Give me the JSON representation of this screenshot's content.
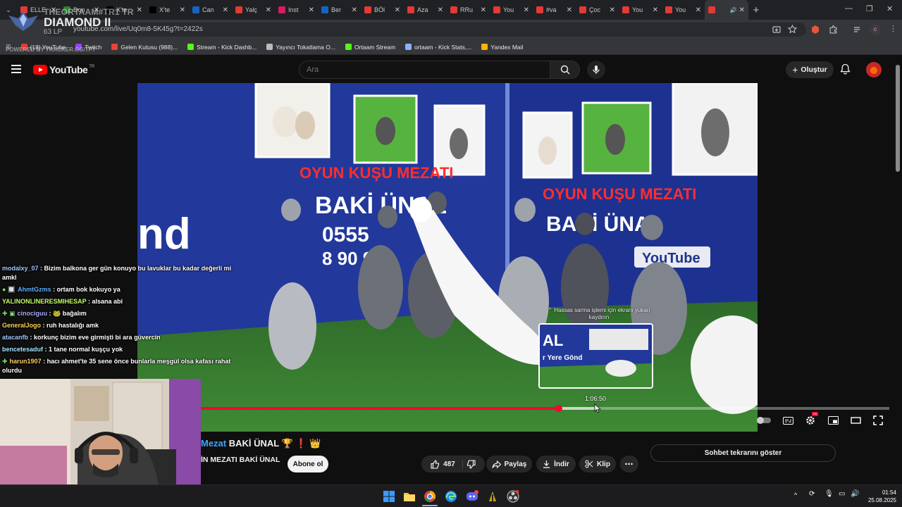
{
  "browser": {
    "tabs": [
      {
        "label": "ELLE",
        "color": "#e53935",
        "icon": "youtube-icon"
      },
      {
        "label": "Don",
        "color": "#2e7d32",
        "icon": "kick-icon"
      },
      {
        "label": "X'te",
        "color": "#000000",
        "icon": "x-icon"
      },
      {
        "label": "X'te",
        "color": "#000000",
        "icon": "x-icon"
      },
      {
        "label": "Can",
        "color": "#1565c0",
        "icon": "m-icon"
      },
      {
        "label": "Yalç",
        "color": "#e53935",
        "icon": "youtube-icon"
      },
      {
        "label": "Inst",
        "color": "#d81b60",
        "icon": "instagram-icon"
      },
      {
        "label": "Ber",
        "color": "#1565c0",
        "icon": "m-icon"
      },
      {
        "label": "BÖl",
        "color": "#e53935",
        "icon": "youtube-icon"
      },
      {
        "label": "Aza",
        "color": "#e53935",
        "icon": "youtube-icon"
      },
      {
        "label": "RRu",
        "color": "#e53935",
        "icon": "youtube-icon"
      },
      {
        "label": "You",
        "color": "#e53935",
        "icon": "youtube-icon"
      },
      {
        "label": "#va",
        "color": "#e53935",
        "icon": "youtube-icon"
      },
      {
        "label": "Çoc",
        "color": "#e53935",
        "icon": "youtube-icon"
      },
      {
        "label": "You",
        "color": "#e53935",
        "icon": "youtube-icon"
      },
      {
        "label": "You",
        "color": "#e53935",
        "icon": "youtube-icon"
      },
      {
        "label": "",
        "color": "#e53935",
        "icon": "youtube-icon",
        "active": true
      }
    ],
    "url": "youtube.com/live/Uq0m8-5K45g?t=2422s",
    "bookmarks": [
      {
        "label": "(18) YouTube",
        "color": "#e53935"
      },
      {
        "label": "Twitch",
        "color": "#9146ff"
      },
      {
        "label": "Gelen Kutusu (988)...",
        "color": "#ea4335"
      },
      {
        "label": "Stream - Kick Dashb...",
        "color": "#53fc18"
      },
      {
        "label": "Yayıncı Tokatlama O...",
        "color": "#bbbbbb"
      },
      {
        "label": "Ortaam Stream",
        "color": "#53fc18"
      },
      {
        "label": "ortaam - Kick Stats,...",
        "color": "#8ab4f8"
      },
      {
        "label": "Yandex Mail",
        "color": "#ffb300"
      }
    ]
  },
  "overlay": {
    "name": "THEORTAAM#TR1 TR",
    "tier": "DIAMOND II",
    "lp": "63 LP",
    "powered": "POWERED BY TRACKER.GG/TFT"
  },
  "youtube": {
    "logo_text": "YouTube",
    "logo_region": "TR",
    "search_placeholder": "Ara",
    "create_label": "Oluştur"
  },
  "player": {
    "scrub_hint": "Hassas sarma işlemi için ekranı yukarı kaydırın",
    "preview_time": "1:06:50",
    "progress_fraction": 0.52,
    "loaded_fraction": 0.575
  },
  "scene_text": {
    "banner_title": "OYUN KUŞU MEZATI",
    "banner_name": "BAKİ ÜNAL",
    "banner_phone": "0555",
    "banner_phone2": "8 90 9",
    "left_fragment": "nd",
    "youtube_badge": "YouTube",
    "preview_title": "AL",
    "preview_sub": "r Yere Gönd"
  },
  "video": {
    "title_highlight": "Mezat",
    "title_rest": " BAKİ ÜNAL 🏆 ❗ 👑",
    "channel": "İN MEZATI BAKİ ÜNAL",
    "subscribe": "Abone ol",
    "likes": "487",
    "share": "Paylaş",
    "download": "İndir",
    "clip": "Klip",
    "chat_replay": "Sohbet tekrarını göster"
  },
  "chat": [
    {
      "user": "modalxy_07",
      "color": "#9ec7ff",
      "badge": "",
      "text": " : Bizim balkona ger gün konuyo bu lavuklar bu kadar değerli mi amkl"
    },
    {
      "user": "AhmtGzms",
      "color": "#5ab0ff",
      "badge": "● 🔲",
      "text": " : ortam bok kokuyo ya"
    },
    {
      "user": "YALINONLINERESMIHESAP",
      "color": "#c8ff66",
      "badge": "",
      "text": " : alsana abi"
    },
    {
      "user": "cinociguu",
      "color": "#a9a9ff",
      "badge": "✚ ▣",
      "text": " : 🐸 bağalım"
    },
    {
      "user": "GeneralJogo",
      "color": "#ffd24d",
      "badge": "",
      "text": " : ruh hastalığı amk"
    },
    {
      "user": "atacanfb",
      "color": "#9ec7ff",
      "badge": "",
      "text": " : korkunç bizim eve girmişti bi ara güvercin"
    },
    {
      "user": "bencetesaduf",
      "color": "#a8e6ff",
      "badge": "",
      "text": " : 1 tane normal kuşçu yok"
    },
    {
      "user": "harun1907",
      "color": "#ffcf66",
      "badge": "✚",
      "text": " : hacı ahmet'te 35 sene önce bunlarla meşgül olsa kafası rahat olurdu"
    }
  ],
  "taskbar": {
    "time": "01:54",
    "date": "25.08.2025"
  },
  "colors": {
    "accent_red": "#ff0033",
    "bg": "#0f0f0f",
    "link_blue": "#3ea6ff"
  }
}
